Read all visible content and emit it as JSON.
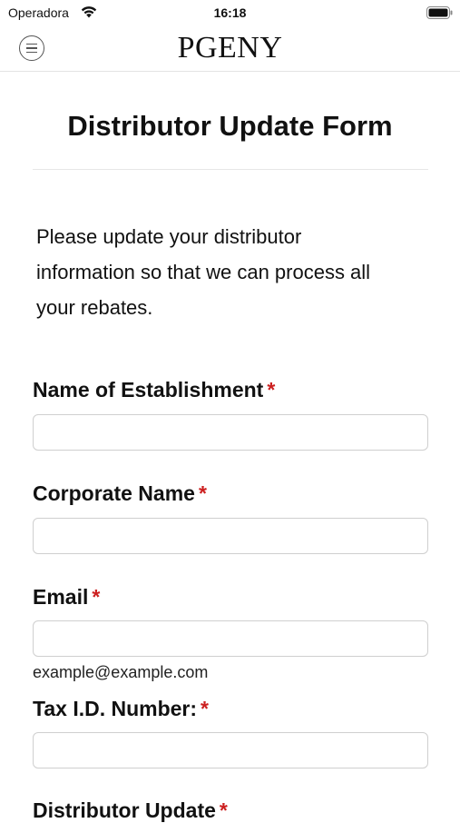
{
  "status_bar": {
    "carrier": "Operadora",
    "time": "16:18"
  },
  "nav": {
    "brand": "PGENY"
  },
  "form": {
    "title": "Distributor Update Form",
    "intro_lines": [
      "Please update your distributor",
      "information so that we can process all",
      "your rebates."
    ],
    "required_mark": "*",
    "fields": [
      {
        "label": "Name of Establishment",
        "value": ""
      },
      {
        "label": "Corporate Name",
        "value": ""
      },
      {
        "label": "Email",
        "value": "",
        "hint": "example@example.com"
      },
      {
        "label": "Tax I.D. Number:",
        "value": ""
      },
      {
        "label": "Distributor Update"
      }
    ]
  },
  "colors": {
    "required": "#cc1f1f",
    "divider": "#e6e6e6",
    "input_border": "#cfcfcf"
  }
}
